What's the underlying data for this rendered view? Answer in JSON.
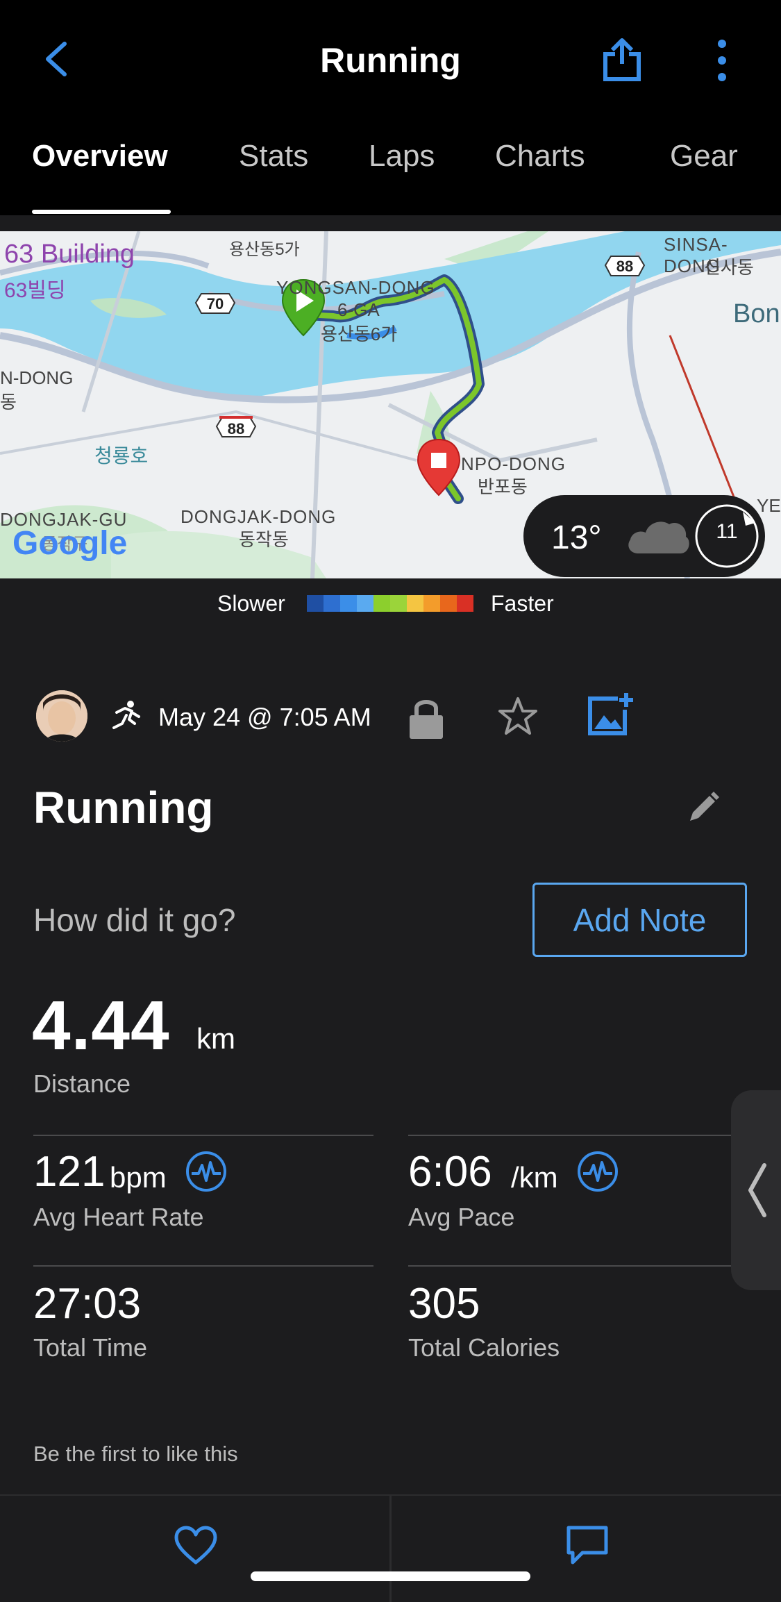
{
  "header": {
    "title": "Running",
    "back_icon": "chevron-left-icon",
    "share_icon": "share-icon",
    "more_icon": "more-vertical-icon"
  },
  "tabs": [
    {
      "label": "Overview",
      "active": true
    },
    {
      "label": "Stats",
      "active": false
    },
    {
      "label": "Laps",
      "active": false
    },
    {
      "label": "Charts",
      "active": false
    },
    {
      "label": "Gear",
      "active": false
    }
  ],
  "map": {
    "labels": {
      "building": "63 Building",
      "building_ko": "63빌딩",
      "yongsan_ko_top": "용산동5가",
      "yongsan": "YONGSAN-DONG",
      "six_ga": "6-GA",
      "yongsan_ko": "용산동6가",
      "sinsa": "SINSA-DONG",
      "sinsa_ko": "신사동",
      "bon": "Bon",
      "ndong": "N-DONG",
      "dong_ko": "동",
      "lake_ko": "청룡호",
      "banpo": "NPO-DONG",
      "banpo_ko": "반포동",
      "dongjak_gu": "DONGJAK-GU",
      "dongjak_gu_ko": "동작구",
      "dongjak_dong": "DONGJAK-DONG",
      "dongjak_dong_ko": "동작동",
      "yec": "YEC",
      "google": "Google",
      "route_70": "70",
      "route_88a": "88",
      "route_88b": "88"
    },
    "weather": {
      "temperature": "13°",
      "wind": "11",
      "condition_icon": "cloud-icon"
    }
  },
  "pace_legend": {
    "slower": "Slower",
    "faster": "Faster",
    "colors": [
      "#1f4fa3",
      "#2e6fd0",
      "#3b8ee8",
      "#5aaaf0",
      "#8ccf2d",
      "#9bd43a",
      "#f4c542",
      "#f39c2b",
      "#e8671c",
      "#d93025"
    ]
  },
  "activity": {
    "date": "May 24 @ 7:05 AM",
    "name": "Running",
    "how_prompt": "How did it go?",
    "add_note": "Add Note",
    "distance": {
      "value": "4.44",
      "unit": "km",
      "label": "Distance"
    },
    "avg_heart_rate": {
      "value": "121",
      "unit": "bpm",
      "label": "Avg Heart Rate"
    },
    "avg_pace": {
      "value": "6:06",
      "unit": "/km",
      "label": "Avg Pace"
    },
    "total_time": {
      "value": "27:03",
      "label": "Total Time"
    },
    "total_calories": {
      "value": "305",
      "label": "Total Calories"
    },
    "likes_text": "Be the first to like this"
  },
  "colors": {
    "accent": "#3b8ee8",
    "background": "#1c1c1e",
    "header": "#000000"
  }
}
